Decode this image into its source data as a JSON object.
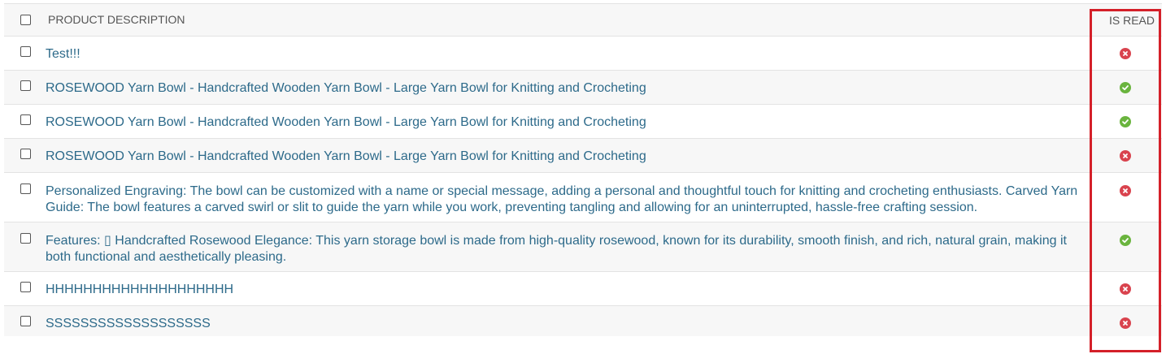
{
  "table": {
    "header": {
      "description_label": "PRODUCT DESCRIPTION",
      "is_read_label": "IS READ"
    },
    "rows": [
      {
        "description": "Test!!!",
        "is_read": false
      },
      {
        "description": "ROSEWOOD Yarn Bowl - Handcrafted Wooden Yarn Bowl - Large Yarn Bowl for Knitting and Crocheting",
        "is_read": true
      },
      {
        "description": "ROSEWOOD Yarn Bowl - Handcrafted Wooden Yarn Bowl - Large Yarn Bowl for Knitting and Crocheting",
        "is_read": true
      },
      {
        "description": "ROSEWOOD Yarn Bowl - Handcrafted Wooden Yarn Bowl - Large Yarn Bowl for Knitting and Crocheting",
        "is_read": false
      },
      {
        "description": "Personalized Engraving: The bowl can be customized with a name or special message, adding a personal and thoughtful touch for knitting and crocheting enthusiasts. Carved Yarn Guide: The bowl features a carved swirl or slit to guide the yarn while you work, preventing tangling and allowing for an uninterrupted, hassle-free crafting session.",
        "is_read": false
      },
      {
        "description": "Features: ▯ Handcrafted Rosewood Elegance: This yarn storage bowl is made from high-quality rosewood, known for its durability, smooth finish, and rich, natural grain, making it both functional and aesthetically pleasing.",
        "is_read": true
      },
      {
        "description": "HHHHHHHHHHHHHHHHHHHH",
        "is_read": false
      },
      {
        "description": "SSSSSSSSSSSSSSSSSSS",
        "is_read": false
      }
    ]
  },
  "colors": {
    "read_true": "#6ab43e",
    "read_false": "#d9434e",
    "link_text": "#2d6a8a",
    "highlight": "#d42029"
  },
  "icons": {
    "read_true": "check-circle-icon",
    "read_false": "x-circle-icon"
  }
}
